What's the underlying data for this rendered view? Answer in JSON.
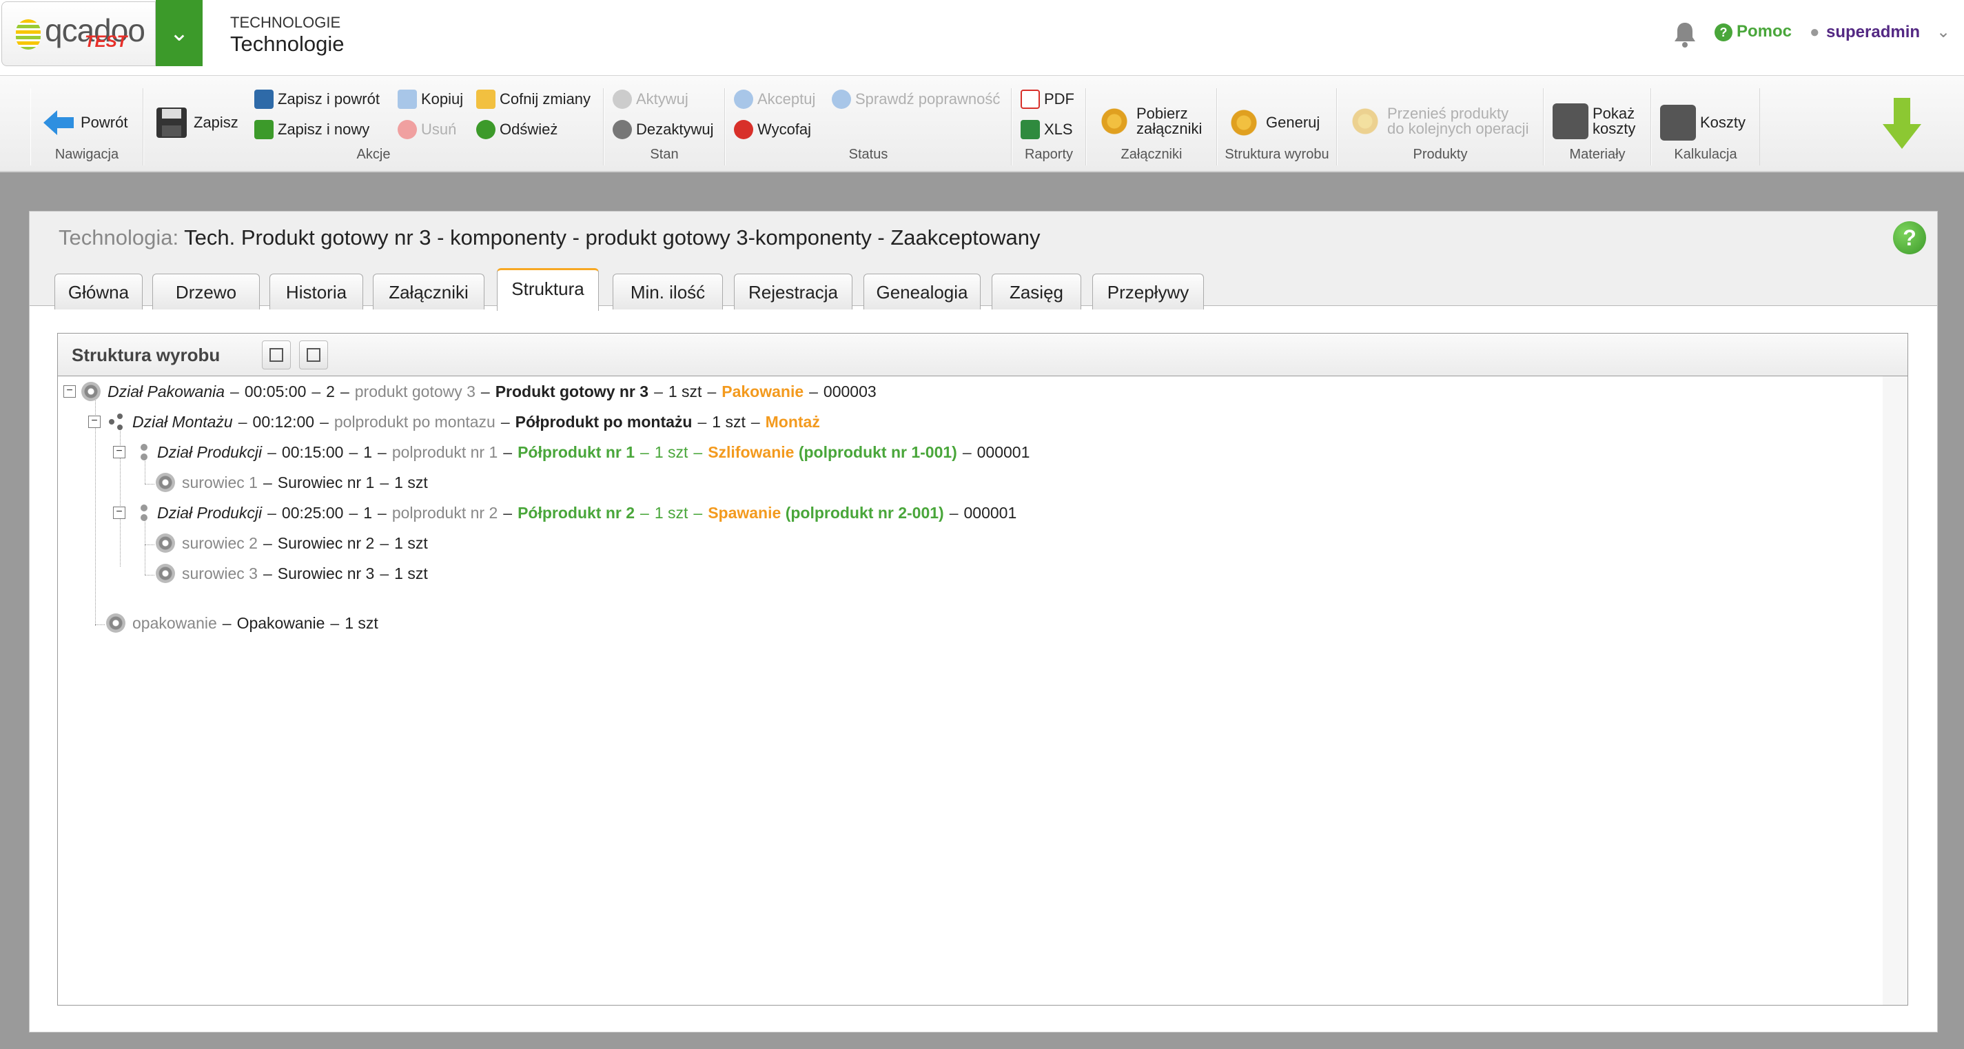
{
  "header": {
    "logo_text": "qcadoo",
    "logo_sub": "TEST",
    "app_small": "TECHNOLOGIE",
    "app_title": "Technologie",
    "help_label": "Pomoc",
    "user_label": "superadmin"
  },
  "ribbon": {
    "groups": {
      "nawigacja": "Nawigacja",
      "akcje": "Akcje",
      "stan": "Stan",
      "status": "Status",
      "raporty": "Raporty",
      "zalaczniki": "Załączniki",
      "struktura": "Struktura wyrobu",
      "produkty": "Produkty",
      "materialy": "Materiały",
      "kalkulacja": "Kalkulacja"
    },
    "back": "Powrót",
    "save": "Zapisz",
    "save_back": "Zapisz i powrót",
    "save_new": "Zapisz i nowy",
    "copy": "Kopiuj",
    "delete": "Usuń",
    "undo": "Cofnij zmiany",
    "refresh": "Odśwież",
    "activate": "Aktywuj",
    "deactivate": "Dezaktywuj",
    "accept": "Akceptuj",
    "withdraw": "Wycofaj",
    "check": "Sprawdź poprawność",
    "pdf": "PDF",
    "xls": "XLS",
    "download_1": "Pobierz",
    "download_2": "załączniki",
    "generate": "Generuj",
    "move_1": "Przenieś produkty",
    "move_2": "do kolejnych operacji",
    "show_1": "Pokaż",
    "show_2": "koszty",
    "costs": "Koszty"
  },
  "panel": {
    "title_label": "Technologia:",
    "title_value": "Tech. Produkt gotowy nr 3 - komponenty - produkt gotowy 3-komponenty - Zaakceptowany",
    "tabs": [
      "Główna",
      "Drzewo",
      "Historia",
      "Załączniki",
      "Struktura",
      "Min. ilość",
      "Rejestracja",
      "Genealogia",
      "Zasięg",
      "Przepływy"
    ],
    "struct_title": "Struktura wyrobu"
  },
  "tree": {
    "n1": {
      "dept": "Dział Pakowania",
      "time": "00:05:00",
      "num": "2",
      "code": "produkt gotowy 3",
      "name": "Produkt gotowy nr 3",
      "qty": "1 szt",
      "op": "Pakowanie",
      "no": "000003"
    },
    "n2": {
      "dept": "Dział Montażu",
      "time": "00:12:00",
      "code": "polprodukt po montazu",
      "name": "Półprodukt po montażu",
      "qty": "1 szt",
      "op": "Montaż"
    },
    "n3": {
      "dept": "Dział Produkcji",
      "time": "00:15:00",
      "num": "1",
      "code": "polprodukt nr 1",
      "name": "Półprodukt nr 1",
      "qty": "1 szt",
      "op": "Szlifowanie",
      "ref": "(polprodukt nr 1-001)",
      "no": "000001"
    },
    "n4": {
      "code": "surowiec 1",
      "name": "Surowiec nr 1",
      "qty": "1 szt"
    },
    "n5": {
      "dept": "Dział Produkcji",
      "time": "00:25:00",
      "num": "1",
      "code": "polprodukt nr 2",
      "name": "Półprodukt nr 2",
      "qty": "1 szt",
      "op": "Spawanie",
      "ref": "(polprodukt nr 2-001)",
      "no": "000001"
    },
    "n6": {
      "code": "surowiec 2",
      "name": "Surowiec nr 2",
      "qty": "1 szt"
    },
    "n7": {
      "code": "surowiec 3",
      "name": "Surowiec nr 3",
      "qty": "1 szt"
    },
    "n8": {
      "code": "opakowanie",
      "name": "Opakowanie",
      "qty": "1 szt"
    }
  }
}
